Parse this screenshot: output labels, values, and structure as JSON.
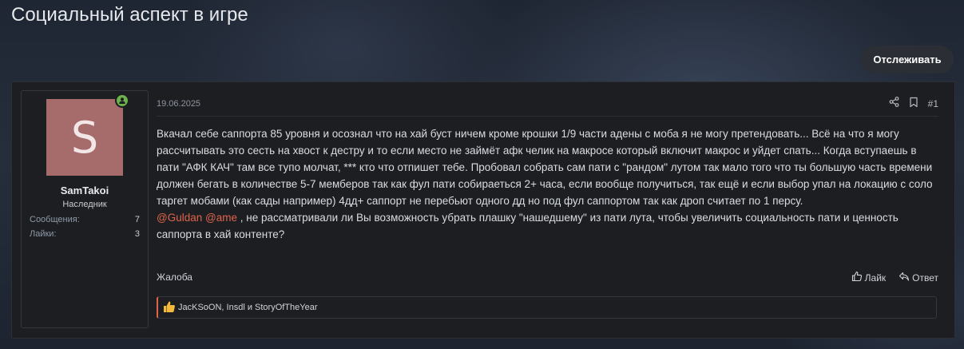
{
  "page": {
    "title": "Социальный аспект в игре"
  },
  "watch_button": {
    "label": "Отслеживать"
  },
  "user": {
    "avatar_letter": "S",
    "avatar_color": "#a66c6c",
    "online_color": "#6bb34a",
    "name": "SamTakoi",
    "title": "Наследник",
    "stats": [
      {
        "label": "Сообщения:",
        "value": "7"
      },
      {
        "label": "Лайки:",
        "value": "3"
      }
    ]
  },
  "post": {
    "date": "19.06.2025",
    "number": "#1",
    "icons": [
      "share-icon",
      "bookmark-icon"
    ],
    "paragraph": "Вкачал себе саппорта 85 уровня и осознал что на хай буст ничем кроме крошки 1/9 части адены с моба я не могу претендовать... Всё на что я могу рассчитывать это сесть на хвост к дестру и то если место не займёт афк челик на макросе который включит макрос и уйдет спать... Когда вступаешь в пати \"АФК КАЧ\" там все тупо молчат, *** кто что отпишет тебе. Пробовал собрать сам пати с \"рандом\" лутом так мало того что ты большую часть времени должен бегать в количестве 5-7 мемберов так как фул пати собираеться 2+ часа, если вообще получиться, так ещё и если выбор упал на локацию с соло таргет мобами (как сады например) 4дд+ саппорт не перебьют одного дд но под фул саппортом так как дроп считает по 1 персу.",
    "mention_1": "@Guldan",
    "mention_2": "@ame",
    "question": " , не рассматривали ли Вы возможность убрать плашку \"нашедшему\" из пати лута, чтобы увеличить социальность пати и ценность саппорта в хай контенте?",
    "report_label": "Жалоба",
    "like_label": "Лайк",
    "reply_label": "Ответ",
    "reactions_text": "JacKSoON, Insdl и StoryOfTheYear",
    "accent_color": "#e0644b"
  }
}
